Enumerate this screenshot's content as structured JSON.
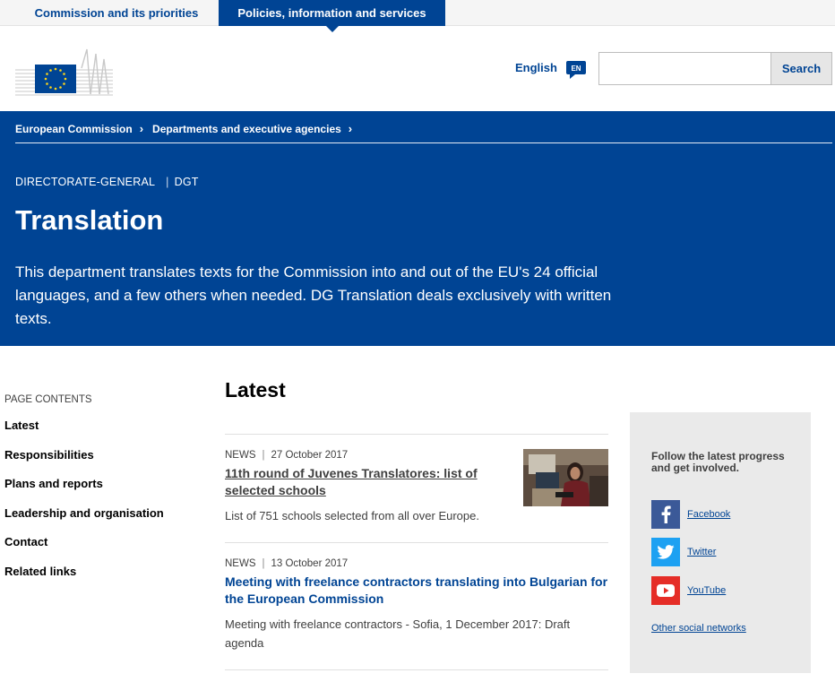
{
  "top_nav": {
    "tabs": [
      {
        "label": "Commission and its priorities"
      },
      {
        "label": "Policies, information and services"
      }
    ]
  },
  "header": {
    "language": "English",
    "language_code": "EN",
    "search": {
      "placeholder": "",
      "button_label": "Search"
    }
  },
  "banner": {
    "breadcrumbs": [
      "European Commission",
      "Departments and executive agencies"
    ],
    "meta": {
      "type": "DIRECTORATE-GENERAL",
      "acronym": "DGT"
    },
    "title": "Translation",
    "intro": "This department translates texts for the Commission into and out of the EU's 24 official languages, and a few others when needed. DG Translation deals exclusively with written texts."
  },
  "page_contents": {
    "label": "PAGE CONTENTS",
    "items": [
      "Latest",
      "Responsibilities",
      "Plans and reports",
      "Leadership and organisation",
      "Contact",
      "Related links"
    ]
  },
  "latest": {
    "heading": "Latest",
    "items": [
      {
        "kind": "NEWS",
        "date": "27 October 2017",
        "headline": "11th round of Juvenes Translatores: list of selected schools",
        "description": "List of 751 schools selected from all over Europe."
      },
      {
        "kind": "NEWS",
        "date": "13 October 2017",
        "headline": "Meeting with freelance contractors translating into Bulgarian for the European Commission",
        "description": "Meeting with freelance contractors - Sofia, 1 December 2017: Draft agenda"
      }
    ]
  },
  "social": {
    "lead": "Follow the latest progress and get involved.",
    "networks": [
      {
        "name": "Facebook",
        "icon": "facebook-icon",
        "color": "#3b5998"
      },
      {
        "name": "Twitter",
        "icon": "twitter-icon",
        "color": "#1da1f2"
      },
      {
        "name": "YouTube",
        "icon": "youtube-icon",
        "color": "#e52d27"
      }
    ],
    "other_label": "Other social networks"
  },
  "colors": {
    "brand_blue": "#004494",
    "eu_yellow": "#ffd617"
  }
}
